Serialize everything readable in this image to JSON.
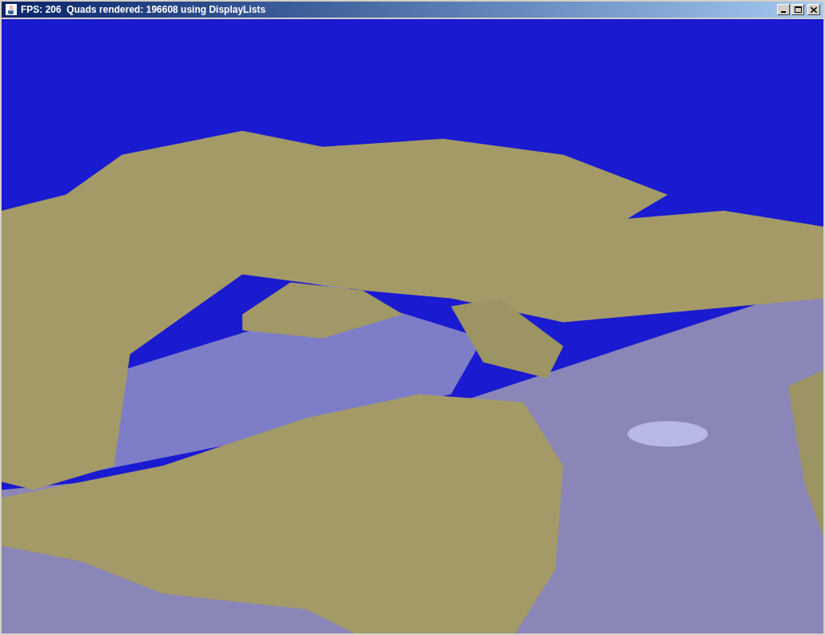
{
  "window": {
    "title": "FPS: 206  Quads rendered: 196608 using DisplayLists"
  }
}
